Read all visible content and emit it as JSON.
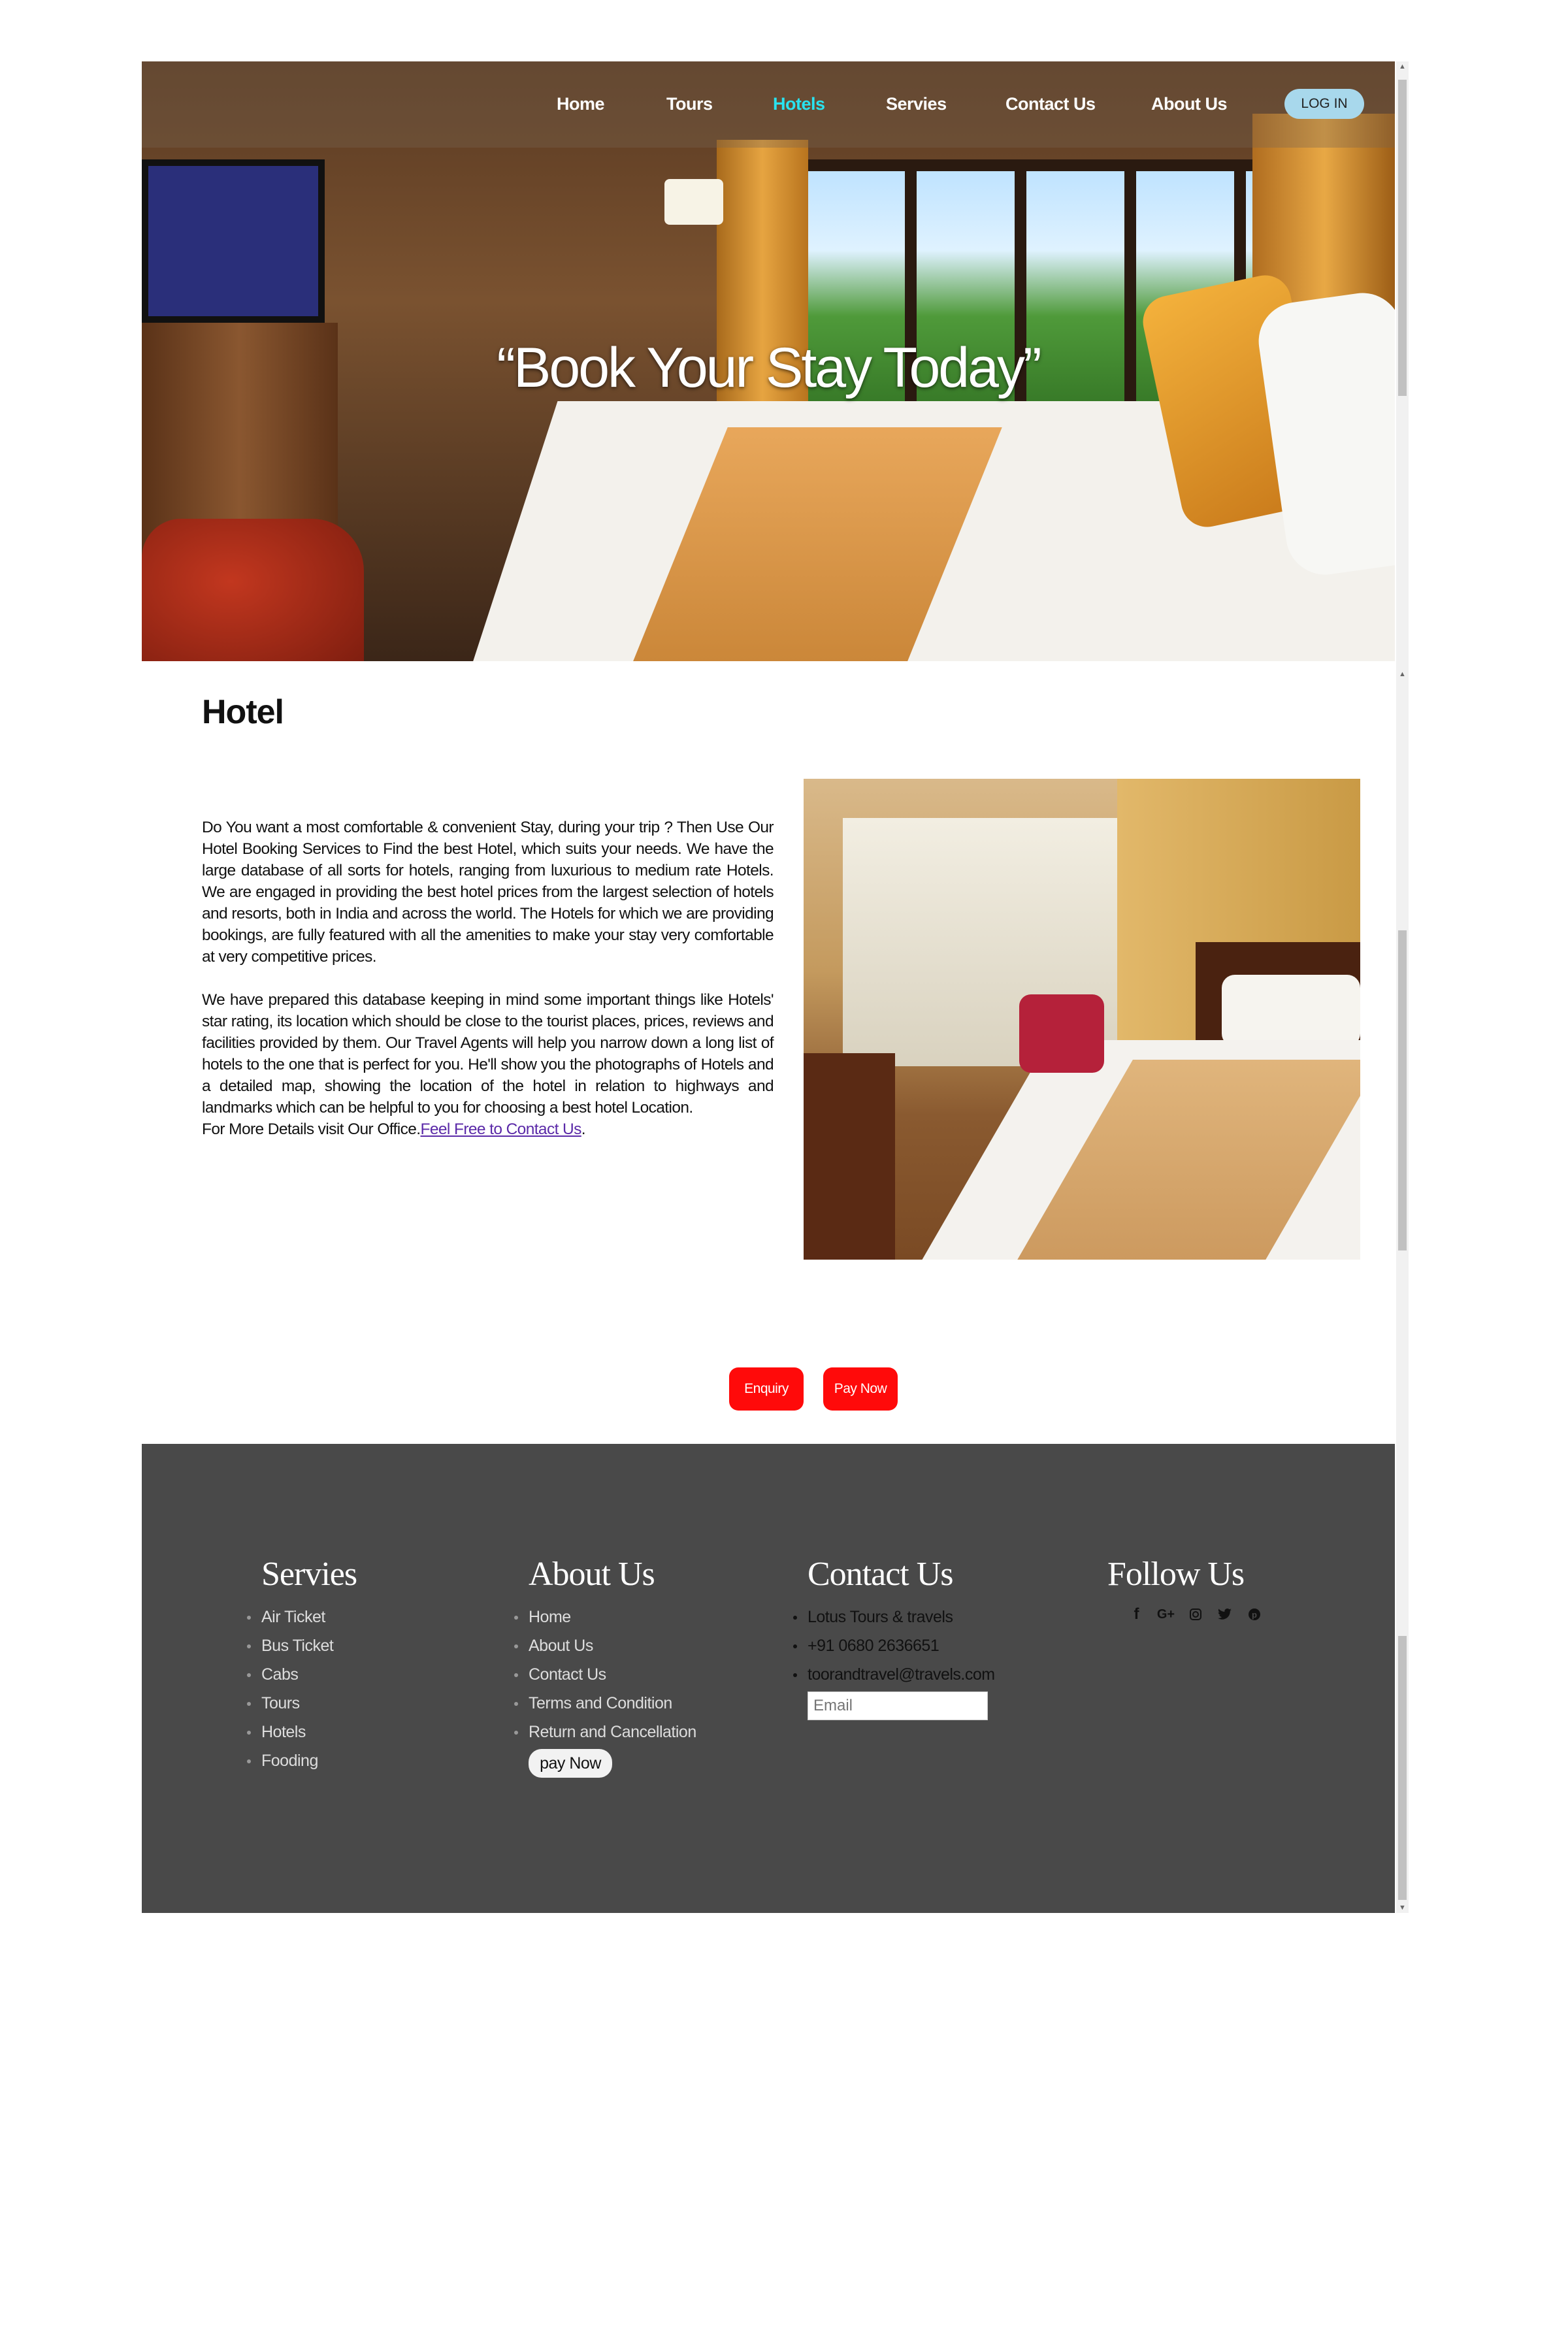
{
  "nav": {
    "items": [
      "Home",
      "Tours",
      "Hotels",
      "Servies",
      "Contact Us",
      "About Us"
    ],
    "active": "Hotels",
    "login": "LOG IN"
  },
  "hero": {
    "title": "“Book Your Stay Today”"
  },
  "content": {
    "title": "Hotel",
    "para1": "Do You want a most comfortable & convenient Stay, during your trip ? Then Use Our Hotel Booking Services to Find the best Hotel, which suits your needs. We have the large database of all sorts for hotels, ranging from luxurious to medium rate Hotels. We are engaged in providing the best hotel prices from the largest selection of hotels and resorts, both in India and across the world. The Hotels for which we are providing bookings, are fully featured with all the amenities to make your stay very comfortable at very competitive prices.",
    "para2": "We have prepared this database keeping in mind some important things like Hotels' star rating, its location which should be close to the tourist places, prices, reviews and facilities provided by them. Our Travel Agents will help you narrow down a long list of hotels to the one that is perfect for you. He'll show you the photographs of Hotels and a detailed map, showing the location of the hotel in relation to highways and landmarks which can be helpful to you for choosing a best hotel Location.",
    "para3_prefix": "For More Details visit Our Office.",
    "para3_link": "Feel Free to Contact Us",
    "para3_suffix": ".",
    "enquiry": "Enquiry",
    "pay_now": "Pay Now"
  },
  "footer": {
    "servies": {
      "title": "Servies",
      "items": [
        "Air Ticket",
        "Bus Ticket",
        "Cabs",
        "Tours",
        "Hotels",
        "Fooding"
      ]
    },
    "about": {
      "title": "About Us",
      "items": [
        "Home",
        "About Us",
        "Contact Us",
        "Terms and Condition",
        "Return and Cancellation"
      ],
      "pay_now": "pay Now"
    },
    "contact": {
      "title": "Contact Us",
      "items": [
        "Lotus Tours & travels",
        "+91 0680 2636651",
        "toorandtravel@travels.com"
      ],
      "email_placeholder": "Email"
    },
    "follow": {
      "title": "Follow Us",
      "icons": [
        "facebook-icon",
        "google-plus-icon",
        "instagram-icon",
        "twitter-icon",
        "pinterest-icon"
      ]
    }
  },
  "colors": {
    "active_nav": "#29e3f0",
    "red_button": "#ff0a0a",
    "footer_bg": "#494949",
    "login_bg": "#a8d8ec",
    "link": "#5b2aa8"
  }
}
